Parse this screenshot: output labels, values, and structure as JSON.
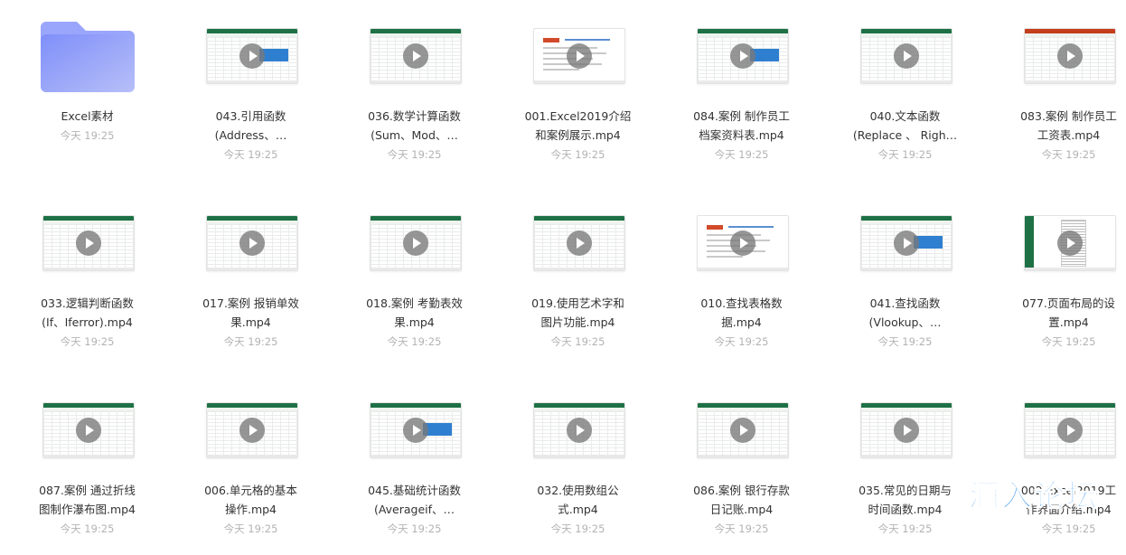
{
  "files": [
    {
      "line1": "Excel素材",
      "line2": "",
      "time": "今天 19:25",
      "type": "folder",
      "icon": "folder-icon"
    },
    {
      "line1": "043.引用函数",
      "line2": "(Address、…",
      "time": "今天 19:25",
      "type": "video",
      "thumb": "sheet-blue"
    },
    {
      "line1": "036.数学计算函数",
      "line2": "(Sum、Mod、…",
      "time": "今天 19:25",
      "type": "video",
      "thumb": "sheet"
    },
    {
      "line1": "001.Excel2019介绍",
      "line2": "和案例展示.mp4",
      "time": "今天 19:25",
      "type": "video",
      "thumb": "doc"
    },
    {
      "line1": "084.案例 制作员工",
      "line2": "档案资料表.mp4",
      "time": "今天 19:25",
      "type": "video",
      "thumb": "sheet-blue"
    },
    {
      "line1": "040.文本函数",
      "line2": "(Replace 、 Righ…",
      "time": "今天 19:25",
      "type": "video",
      "thumb": "sheet"
    },
    {
      "line1": "083.案例 制作员工",
      "line2": "工资表.mp4",
      "time": "今天 19:25",
      "type": "video",
      "thumb": "ppt"
    },
    {
      "line1": "033.逻辑判断函数",
      "line2": "(If、Iferror).mp4",
      "time": "今天 19:25",
      "type": "video",
      "thumb": "sheet"
    },
    {
      "line1": "017.案例 报销单效",
      "line2": "果.mp4",
      "time": "今天 19:25",
      "type": "video",
      "thumb": "sheet"
    },
    {
      "line1": "018.案例 考勤表效",
      "line2": "果.mp4",
      "time": "今天 19:25",
      "type": "video",
      "thumb": "sheet"
    },
    {
      "line1": "019.使用艺术字和",
      "line2": "图片功能.mp4",
      "time": "今天 19:25",
      "type": "video",
      "thumb": "sheet"
    },
    {
      "line1": "010.查找表格数",
      "line2": "据.mp4",
      "time": "今天 19:25",
      "type": "video",
      "thumb": "doc"
    },
    {
      "line1": "041.查找函数",
      "line2": "(Vlookup、…",
      "time": "今天 19:25",
      "type": "video",
      "thumb": "sheet-blue"
    },
    {
      "line1": "077.页面布局的设",
      "line2": "置.mp4",
      "time": "今天 19:25",
      "type": "video",
      "thumb": "layout"
    },
    {
      "line1": "087.案例 通过折线",
      "line2": "图制作瀑布图.mp4",
      "time": "今天 19:25",
      "type": "video",
      "thumb": "sheet"
    },
    {
      "line1": "006.单元格的基本",
      "line2": "操作.mp4",
      "time": "今天 19:25",
      "type": "video",
      "thumb": "sheet"
    },
    {
      "line1": "045.基础统计函数",
      "line2": "(Averageif、…",
      "time": "今天 19:25",
      "type": "video",
      "thumb": "sheet-blue"
    },
    {
      "line1": "032.使用数组公",
      "line2": "式.mp4",
      "time": "今天 19:25",
      "type": "video",
      "thumb": "sheet"
    },
    {
      "line1": "086.案例 银行存款",
      "line2": "日记账.mp4",
      "time": "今天 19:25",
      "type": "video",
      "thumb": "sheet"
    },
    {
      "line1": "035.常见的日期与",
      "line2": "时间函数.mp4",
      "time": "今天 19:25",
      "type": "video",
      "thumb": "sheet"
    },
    {
      "line1": "002.Excel2019工",
      "line2": "作界面介绍.mp4",
      "time": "今天 19:25",
      "type": "video",
      "thumb": "sheet"
    }
  ],
  "watermark": {
    "text": "酒入论坛",
    "icon": "watermark-logo",
    "color": "#2a8ff0"
  },
  "colors": {
    "excel_green": "#1e7145",
    "ppt_orange": "#c43e1c",
    "folder": "#8f9dfb",
    "text": "#333333",
    "time": "#b3b3b3"
  }
}
